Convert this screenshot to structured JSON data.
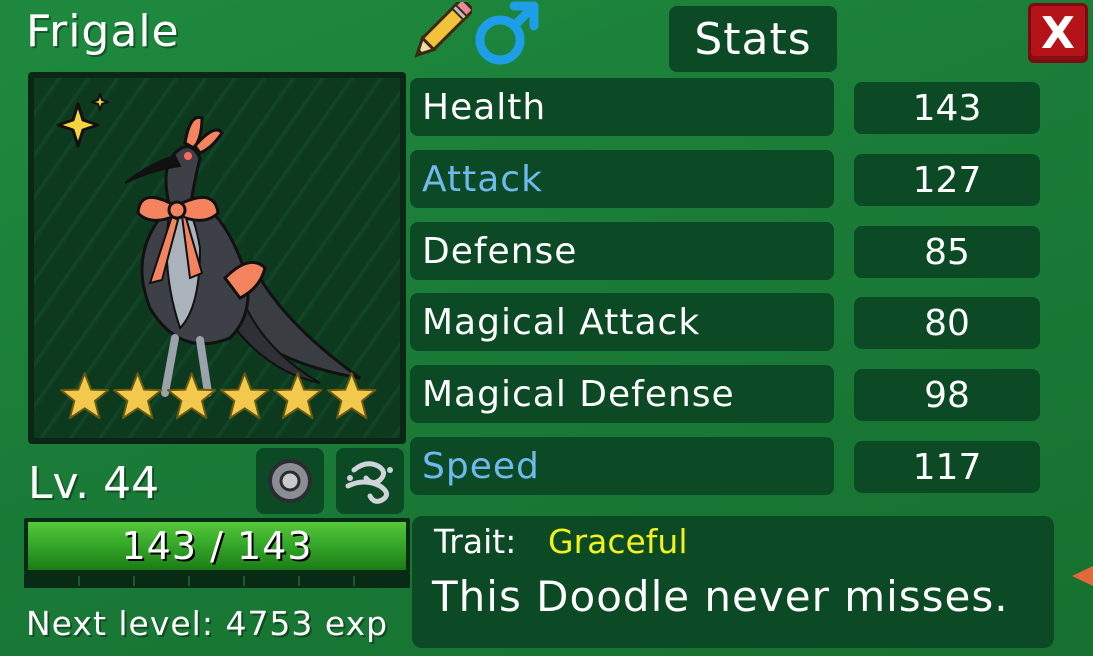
{
  "doodle": {
    "name": "Frigale",
    "gender_icon": "male-symbol",
    "rename_icon": "pencil",
    "shiny_icon": "sparkle",
    "stars": 6,
    "level_text": "Lv. 44",
    "hp_text": "143 / 143",
    "hp_fraction": 1.0,
    "next_level_text": "Next level: 4753 exp",
    "held_item_icon": "disc",
    "ability_icon": "wind-swirl"
  },
  "header": {
    "stats_title": "Stats",
    "close_label": "X"
  },
  "stats": [
    {
      "label": "Health",
      "value": "143",
      "boosted": false
    },
    {
      "label": "Attack",
      "value": "127",
      "boosted": true
    },
    {
      "label": "Defense",
      "value": "85",
      "boosted": false
    },
    {
      "label": "Magical Attack",
      "value": "80",
      "boosted": false
    },
    {
      "label": "Magical Defense",
      "value": "98",
      "boosted": false
    },
    {
      "label": "Speed",
      "value": "117",
      "boosted": true
    }
  ],
  "trait": {
    "label": "Trait:",
    "name": "Graceful",
    "description": "This Doodle never misses."
  },
  "colors": {
    "background": "#1a7c38",
    "panel": "#0b4a25",
    "boosted_stat": "#6fb9ee",
    "trait_name": "#f2f21e",
    "close_button": "#b5121a",
    "star": "#f2c94c"
  }
}
